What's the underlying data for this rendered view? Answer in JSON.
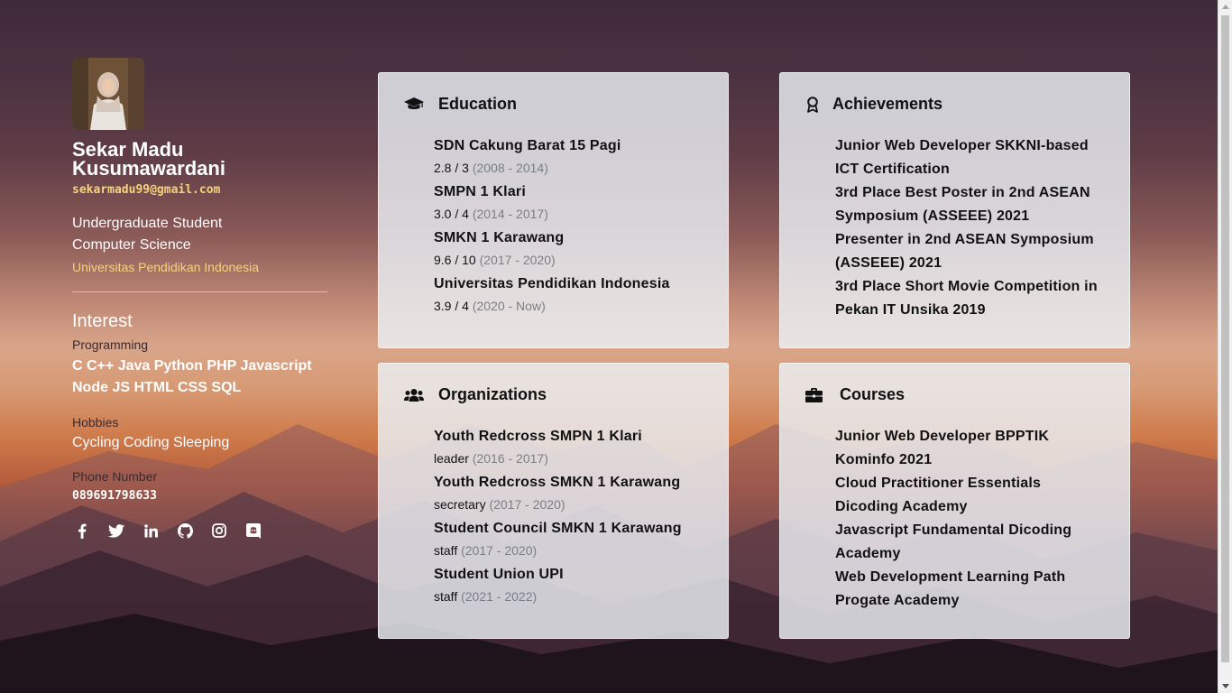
{
  "profile": {
    "name": "Sekar Madu Kusumawardani",
    "email": "sekarmadu99@gmail.com",
    "role_line1": "Undergraduate Student",
    "role_line2": "Computer Science",
    "university": "Universitas Pendidikan Indonesia"
  },
  "interest": {
    "title": "Interest",
    "programming_label": "Programming",
    "languages_line1": "C C++ Java Python PHP Javascript",
    "languages_line2": "Node JS HTML CSS SQL",
    "hobbies_label": "Hobbies",
    "hobbies": "Cycling Coding Sleeping",
    "phone_label": "Phone Number",
    "phone": "089691798633"
  },
  "socials": [
    "facebook-icon",
    "twitter-icon",
    "linkedin-icon",
    "github-icon",
    "instagram-icon",
    "discord-icon"
  ],
  "education": {
    "title": "Education",
    "items": [
      {
        "name": "SDN Cakung Barat 15 Pagi",
        "score": "2.8 / 3",
        "period": "(2008 - 2014)"
      },
      {
        "name": "SMPN 1 Klari",
        "score": "3.0 / 4",
        "period": "(2014 - 2017)"
      },
      {
        "name": "SMKN 1 Karawang",
        "score": "9.6 / 10",
        "period": "(2017 - 2020)"
      },
      {
        "name": "Universitas Pendidikan Indonesia",
        "score": "3.9 / 4",
        "period": "(2020 - Now)"
      }
    ]
  },
  "achievements": {
    "title": "Achievements",
    "items": [
      "Junior Web Developer SKKNI-based ICT Certification",
      "3rd Place Best Poster in 2nd ASEAN Symposium (ASSEEE) 2021",
      "Presenter in 2nd ASEAN Symposium (ASSEEE) 2021",
      "3rd Place Short Movie Competition in Pekan IT Unsika 2019"
    ]
  },
  "organizations": {
    "title": "Organizations",
    "items": [
      {
        "name": "Youth Redcross SMPN 1 Klari",
        "role": "leader",
        "period": "(2016 - 2017)"
      },
      {
        "name": "Youth Redcross SMKN 1 Karawang",
        "role": "secretary",
        "period": "(2017 - 2020)"
      },
      {
        "name": "Student Council SMKN 1 Karawang",
        "role": "staff",
        "period": "(2017 - 2020)"
      },
      {
        "name": "Student Union UPI",
        "role": "staff",
        "period": "(2021 - 2022)"
      }
    ]
  },
  "courses": {
    "title": "Courses",
    "items": [
      "Junior Web Developer BPPTIK Kominfo 2021",
      "Cloud Practitioner Essentials Dicoding Academy",
      "Javascript Fundamental Dicoding Academy",
      "Web Development Learning Path Progate Academy"
    ]
  }
}
